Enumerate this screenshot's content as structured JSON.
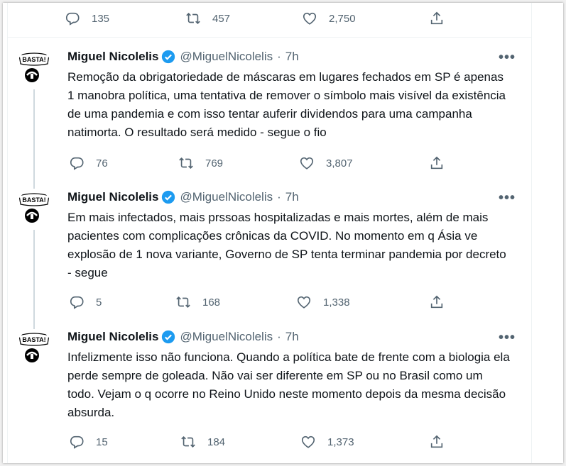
{
  "top_actions": {
    "reply": "135",
    "retweet": "457",
    "like": "2,750"
  },
  "tweets": [
    {
      "name": "Miguel Nicolelis",
      "handle": "@MiguelNicolelis",
      "time": "7h",
      "text": "Remoção da obrigatoriedade de máscaras em lugares fechados em SP é apenas 1 manobra política, uma tentativa de remover o símbolo mais visível da existência de uma pandemia e com isso tentar auferir dividendos para uma campanha natimorta. O resultado será medido - segue o fio",
      "reply": "76",
      "retweet": "769",
      "like": "3,807"
    },
    {
      "name": "Miguel Nicolelis",
      "handle": "@MiguelNicolelis",
      "time": "7h",
      "text": "Em mais infectados, mais prssoas hospitalizadas e mais mortes, além de mais pacientes com complicações crônicas da COVID. No momento em q Ásia ve explosão de 1 nova variante, Governo de SP tenta terminar pandemia por decreto - segue",
      "reply": "5",
      "retweet": "168",
      "like": "1,338"
    },
    {
      "name": "Miguel Nicolelis",
      "handle": "@MiguelNicolelis",
      "time": "7h",
      "text": "Infelizmente isso não funciona. Quando a política bate de frente com a biologia ela perde sempre de goleada. Não vai ser diferente em SP ou no Brasil como um todo. Vejam o q ocorre no Reino Unido neste momento depois da mesma decisão absurda.",
      "reply": "15",
      "retweet": "184",
      "like": "1,373"
    }
  ],
  "avatar_text": "BASTA!",
  "icons": {
    "reply": "reply-icon",
    "retweet": "retweet-icon",
    "like": "heart-icon",
    "share": "share-icon",
    "verified": "verified-badge-icon",
    "more": "more-icon"
  },
  "colors": {
    "verified": "#1d9bf0",
    "muted": "#536471",
    "text": "#0f1419"
  }
}
